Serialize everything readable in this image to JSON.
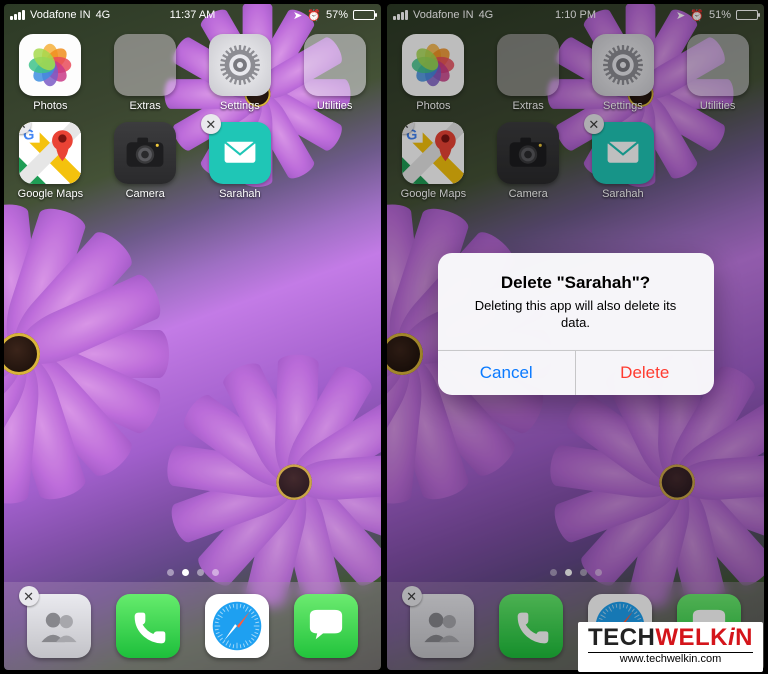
{
  "watermark": {
    "brand_a": "TECH",
    "brand_b": "WELK",
    "brand_c": "i",
    "brand_d": "N",
    "url": "www.techwelkin.com"
  },
  "screens": {
    "left": {
      "status": {
        "carrier": "Vodafone IN",
        "net": "4G",
        "time": "11:37 AM",
        "battery_pct": "57%",
        "battery_fill": 57,
        "alarm": "⏰"
      },
      "apps_row1": [
        {
          "label": "Photos",
          "name": "photos-app",
          "ic": "ic-photos"
        },
        {
          "label": "Extras",
          "name": "extras-folder",
          "ic": "ic-extras"
        },
        {
          "label": "Settings",
          "name": "settings-app",
          "ic": "ic-settings"
        },
        {
          "label": "Utilities",
          "name": "utilities-folder",
          "ic": "ic-utilities"
        }
      ],
      "apps_row2": [
        {
          "label": "Google Maps",
          "name": "google-maps-app",
          "ic": "ic-gmaps",
          "deletable": true
        },
        {
          "label": "Camera",
          "name": "camera-app",
          "ic": "ic-camera"
        },
        {
          "label": "Sarahah",
          "name": "sarahah-app",
          "ic": "ic-sarahah",
          "deletable": true
        }
      ],
      "pages": 4,
      "page_active": 1,
      "dock": [
        {
          "name": "contacts-app",
          "ic": "ic-contacts",
          "deletable": true
        },
        {
          "name": "phone-app",
          "ic": "ic-phone"
        },
        {
          "name": "safari-app",
          "ic": "ic-safari"
        },
        {
          "name": "messages-app",
          "ic": "ic-messages"
        }
      ]
    },
    "right": {
      "status": {
        "carrier": "Vodafone IN",
        "net": "4G",
        "time": "1:10 PM",
        "battery_pct": "51%",
        "battery_fill": 51,
        "alarm": "⏰"
      },
      "apps_row1": [
        {
          "label": "Photos",
          "name": "photos-app",
          "ic": "ic-photos"
        },
        {
          "label": "Extras",
          "name": "extras-folder",
          "ic": "ic-extras"
        },
        {
          "label": "Settings",
          "name": "settings-app",
          "ic": "ic-settings"
        },
        {
          "label": "Utilities",
          "name": "utilities-folder",
          "ic": "ic-utilities"
        }
      ],
      "apps_row2": [
        {
          "label": "Google Maps",
          "name": "google-maps-app",
          "ic": "ic-gmaps",
          "deletable": true
        },
        {
          "label": "Camera",
          "name": "camera-app",
          "ic": "ic-camera"
        },
        {
          "label": "Sarahah",
          "name": "sarahah-app",
          "ic": "ic-sarahah",
          "deletable": true
        }
      ],
      "pages": 4,
      "page_active": 1,
      "dock": [
        {
          "name": "contacts-app",
          "ic": "ic-contacts",
          "deletable": true
        },
        {
          "name": "phone-app",
          "ic": "ic-phone"
        },
        {
          "name": "safari-app",
          "ic": "ic-safari"
        },
        {
          "name": "messages-app",
          "ic": "ic-messages"
        }
      ],
      "dialog": {
        "title": "Delete \"Sarahah\"?",
        "message": "Deleting this app will also delete its data.",
        "cancel": "Cancel",
        "delete": "Delete"
      }
    }
  }
}
